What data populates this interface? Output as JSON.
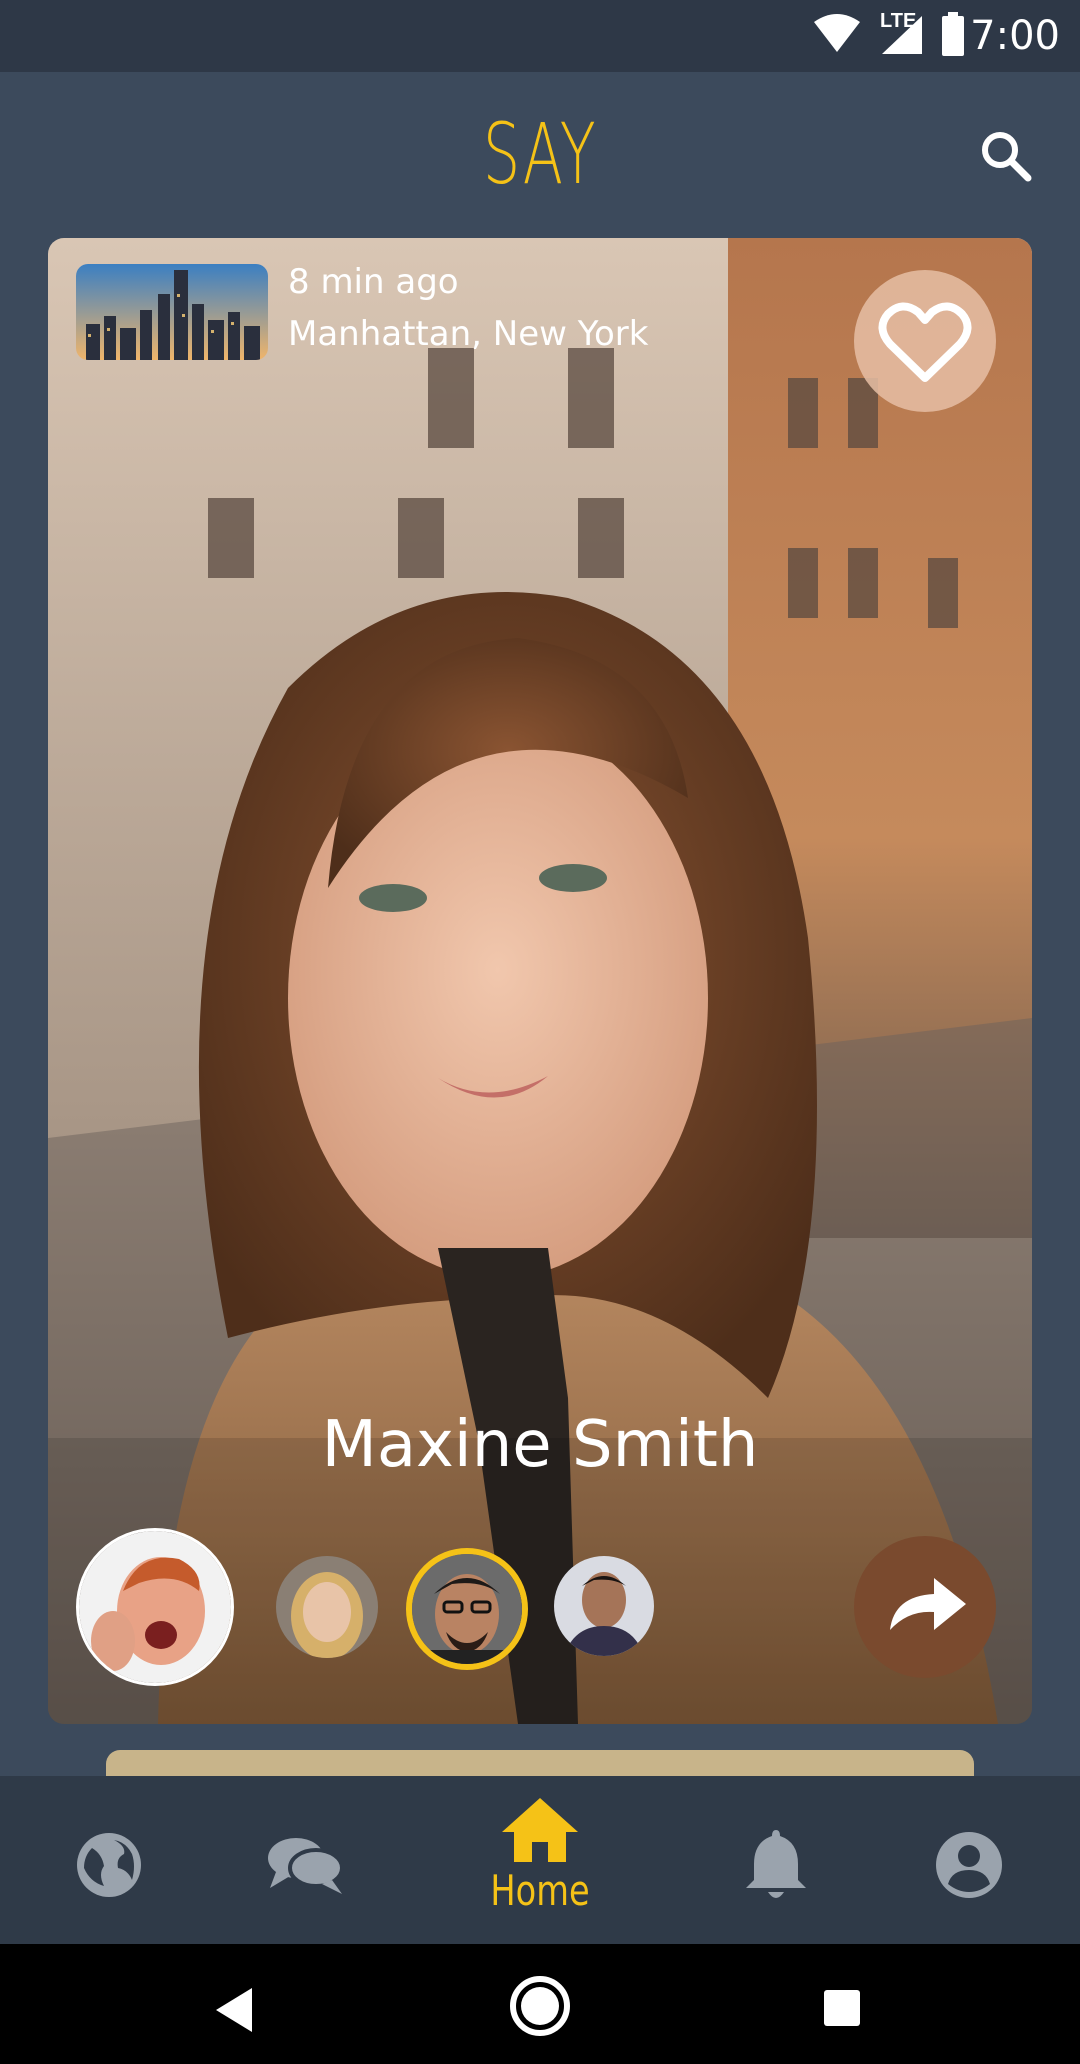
{
  "status_bar": {
    "time": "7:00",
    "network": "LTE",
    "icons": [
      "wifi-icon",
      "signal-icon",
      "battery-icon"
    ]
  },
  "app_bar": {
    "title": "SAY",
    "search_icon": "search-icon"
  },
  "post": {
    "time_ago": "8 min ago",
    "location": "Manhattan, New York",
    "author_name": "Maxine Smith",
    "like_icon": "heart-outline-icon",
    "share_icon": "share-arrow-icon",
    "viewers_count_shown": 4,
    "selected_viewer_index": 2
  },
  "bottom_nav": {
    "items": [
      {
        "icon": "globe-icon",
        "label": ""
      },
      {
        "icon": "chat-icon",
        "label": ""
      },
      {
        "icon": "home-icon",
        "label": "Home",
        "active": true
      },
      {
        "icon": "bell-icon",
        "label": ""
      },
      {
        "icon": "account-icon",
        "label": ""
      }
    ]
  },
  "colors": {
    "accent": "#f5c217",
    "background": "#3c4a5c",
    "nav_background": "#2f3a48",
    "status_bar": "#2e3847"
  }
}
